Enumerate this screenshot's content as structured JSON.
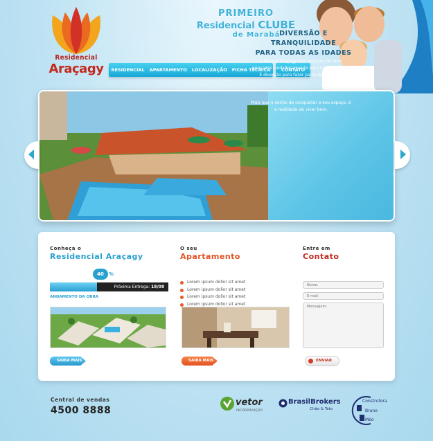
{
  "brand": {
    "name_line1": "Residencial",
    "name_line2": "Araçagy"
  },
  "tagline": {
    "line1": "PRIMEIRO",
    "line2_a": "Residencial ",
    "line2_b": "CLUBE",
    "line3": "de Marabá"
  },
  "nav": {
    "items": [
      "RESIDENCIAL",
      "APARTAMENTO",
      "LOCALIZAÇÃO",
      "FICHA TÉCNICA"
    ],
    "contact": "CONTATO"
  },
  "slider": {
    "title_line1": "DIVERSÃO E TRANQUILIDADE",
    "title_line2": "PARA TODAS AS IDADES",
    "paragraph1": "O Parque Araçagy tem espaços de lazer pensados cuidadosamente para toda a família. É diversão para fazer parte da sua vida.",
    "paragraph2": "Mais que o sonho de conquistar o seu espaço, é a realidade de viver bem."
  },
  "col1": {
    "heading_small": "Conheça o",
    "heading_big": "Residencial Araçagy",
    "progress_value": 40,
    "progress_label": "40",
    "progress_unit": "%",
    "next_delivery_label": "Próxima Entrega:",
    "next_delivery_value": "18/08",
    "status_label": "ANDAMENTO DA OBRA",
    "more_button": "SAIBA MAIS"
  },
  "col2": {
    "heading_small": "O seu",
    "heading_big": "Apartamento",
    "bullets": [
      "Lorem ipsum dollor sit amet",
      "Lorem ipsum dollor sit amet",
      "Lorem ipsum dollor sit amet",
      "Lorem ipsum dollor sit amet"
    ],
    "more_button": "SAIBA MAIS"
  },
  "col3": {
    "heading_small": "Entre em",
    "heading_big": "Contato",
    "name_placeholder": "Nome:",
    "email_placeholder": "E-mail:",
    "message_placeholder": "Mensagem:",
    "send_button": "ENVIAR"
  },
  "footer": {
    "central_label": "Central de vendas",
    "central_number": "4500 8888",
    "partner1_name": "vetor",
    "partner1_sub": "INCORPORAÇÃO",
    "partner2_name": "BrasilBrokers",
    "partner2_sub": "Chão & Teto",
    "partner3_t1": "Construtora",
    "partner3_t2": "Bruno",
    "partner3_t3": "Méo"
  },
  "colors": {
    "accent_blue": "#2aa0cf",
    "accent_orange": "#e4521f",
    "accent_red": "#c22a1f"
  }
}
